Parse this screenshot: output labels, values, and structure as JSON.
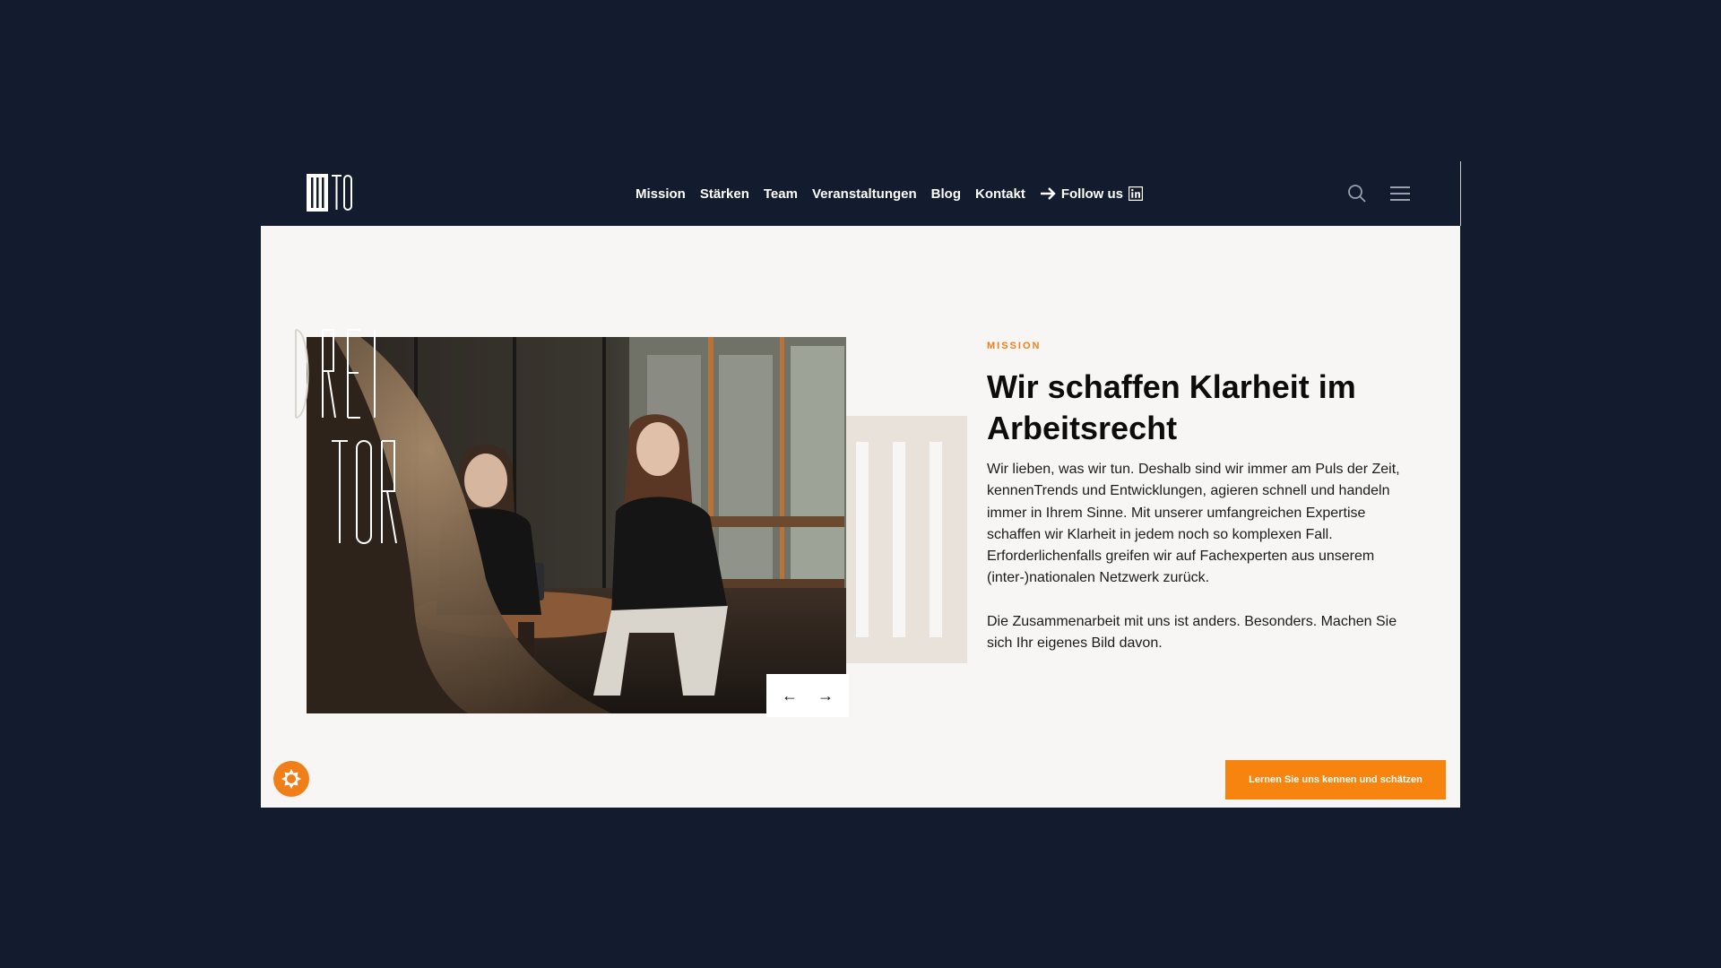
{
  "header": {
    "logo_icon": "dreitor-logo-icon",
    "nav": [
      {
        "label": "Mission"
      },
      {
        "label": "Stärken"
      },
      {
        "label": "Team"
      },
      {
        "label": "Veranstaltungen"
      },
      {
        "label": "Blog"
      },
      {
        "label": "Kontakt"
      }
    ],
    "follow_label": "Follow us",
    "follow_icons": [
      "arrow-right-icon",
      "linkedin-icon"
    ],
    "search_icon": "search-icon",
    "menu_icon": "hamburger-menu-icon"
  },
  "hero": {
    "image_icon": "team-meeting-photo",
    "brand_word_1": "DREI",
    "brand_word_2": "TOR",
    "slider": {
      "prev": "←",
      "next": "→"
    }
  },
  "content": {
    "eyebrow": "MISSION",
    "title": "Wir schaffen Klarheit im Arbeitsrecht",
    "paragraph_1": "Wir lieben, was wir tun. Deshalb sind wir immer am Puls der Zeit, kennenTrends und Entwicklungen, agieren schnell und handeln immer in Ihrem Sinne. Mit unserer umfangreichen Expertise schaffen wir Klarheit in jedem noch so komplexen Fall. Erforderlichenfalls greifen wir auf Fachexperten aus unserem (inter-)nationalen Netzwerk zurück.",
    "paragraph_2": "Die Zusammenarbeit mit uns ist anders. Besonders. Machen Sie sich Ihr eigenes Bild davon.",
    "cta_label": "Lernen Sie uns kennen und schätzen"
  },
  "cookie_icon": "cookie-settings-icon",
  "colors": {
    "background": "#131b2f",
    "panel": "#f7f6f4",
    "accent": "#f07f1a",
    "beige": "#e8e2da"
  }
}
